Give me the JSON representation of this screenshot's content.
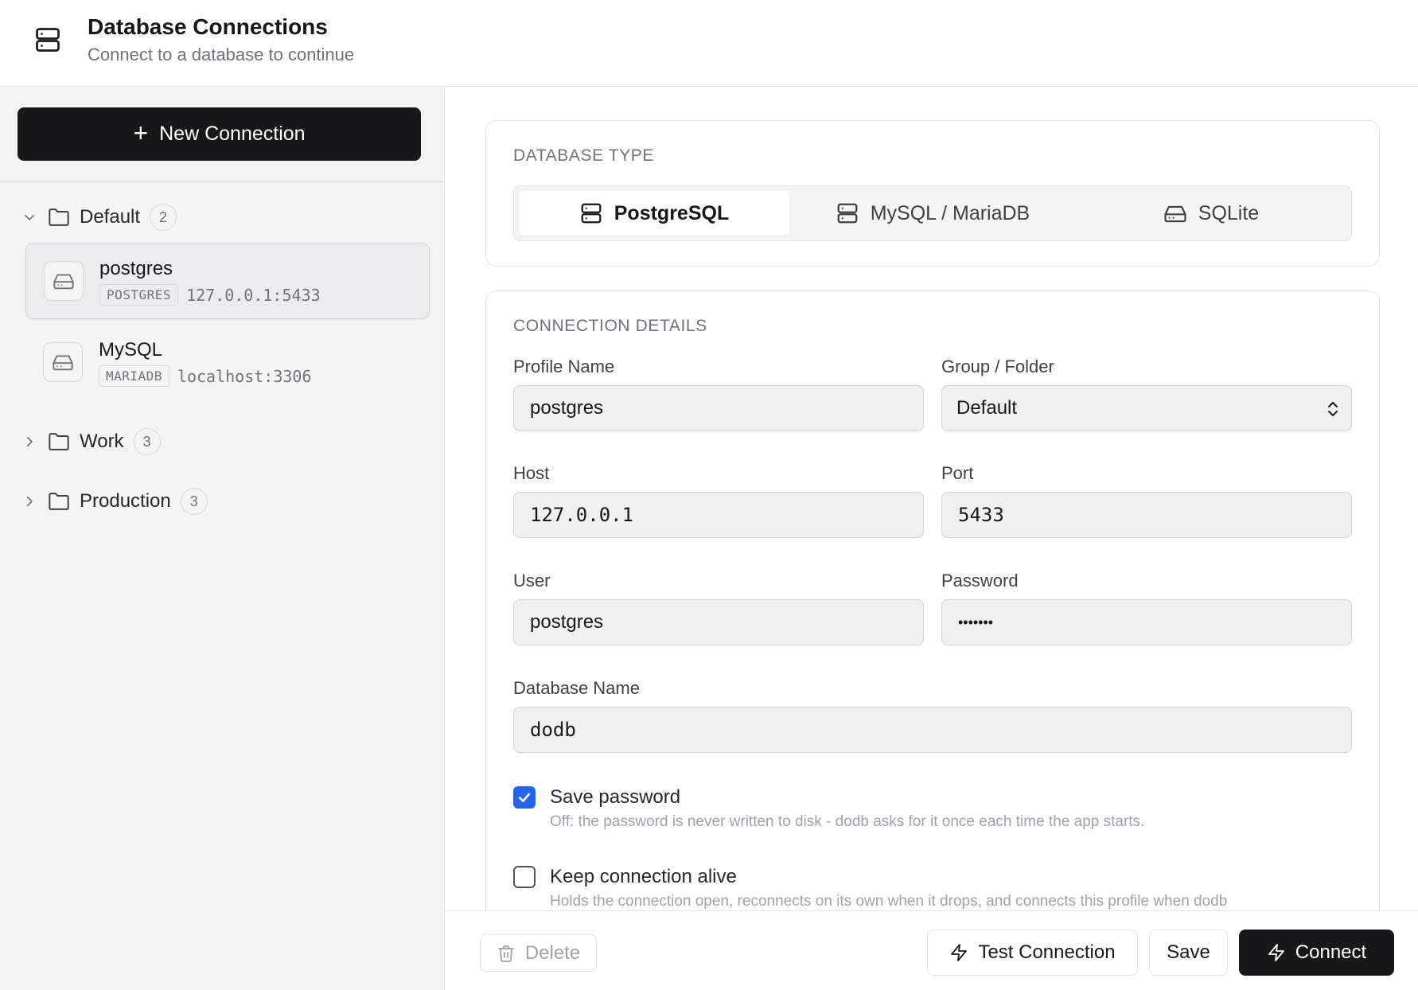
{
  "header": {
    "title": "Database Connections",
    "subtitle": "Connect to a database to continue",
    "icon": "server-icon"
  },
  "sidebar": {
    "new_connection_label": "New Connection",
    "groups": [
      {
        "name": "Default",
        "count": "2",
        "expanded": true,
        "connections": [
          {
            "name": "postgres",
            "kind": "POSTGRES",
            "address": "127.0.0.1:5433",
            "active": true
          },
          {
            "name": "MySQL",
            "kind": "MARIADB",
            "address": "localhost:3306",
            "active": false
          }
        ]
      },
      {
        "name": "Work",
        "count": "3",
        "expanded": false
      },
      {
        "name": "Production",
        "count": "3",
        "expanded": false
      }
    ]
  },
  "database_type": {
    "title": "DATABASE TYPE",
    "options": [
      {
        "label": "PostgreSQL",
        "icon": "server-icon",
        "selected": true
      },
      {
        "label": "MySQL / MariaDB",
        "icon": "server-icon",
        "selected": false
      },
      {
        "label": "SQLite",
        "icon": "hard-drive-icon",
        "selected": false
      }
    ]
  },
  "connection_details": {
    "title": "CONNECTION DETAILS",
    "profile_name": {
      "label": "Profile Name",
      "value": "postgres"
    },
    "group_folder": {
      "label": "Group / Folder",
      "value": "Default"
    },
    "host": {
      "label": "Host",
      "value": "127.0.0.1"
    },
    "port": {
      "label": "Port",
      "value": "5433"
    },
    "user": {
      "label": "User",
      "value": "postgres"
    },
    "password": {
      "label": "Password",
      "value": "•••••••"
    },
    "database_name": {
      "label": "Database Name",
      "value": "dodb"
    },
    "save_password": {
      "label": "Save password",
      "checked": true,
      "help": "Off: the password is never written to disk - dodb asks for it once each time the app starts."
    },
    "keep_alive": {
      "label": "Keep connection alive",
      "checked": false,
      "help": "Holds the connection open, reconnects on its own when it drops, and connects this profile when dodb"
    }
  },
  "footer": {
    "delete_label": "Delete",
    "test_label": "Test Connection",
    "save_label": "Save",
    "connect_label": "Connect"
  },
  "colors": {
    "primary": "#18181b",
    "accent": "#2563eb",
    "sidebar_bg": "#f4f4f5"
  }
}
